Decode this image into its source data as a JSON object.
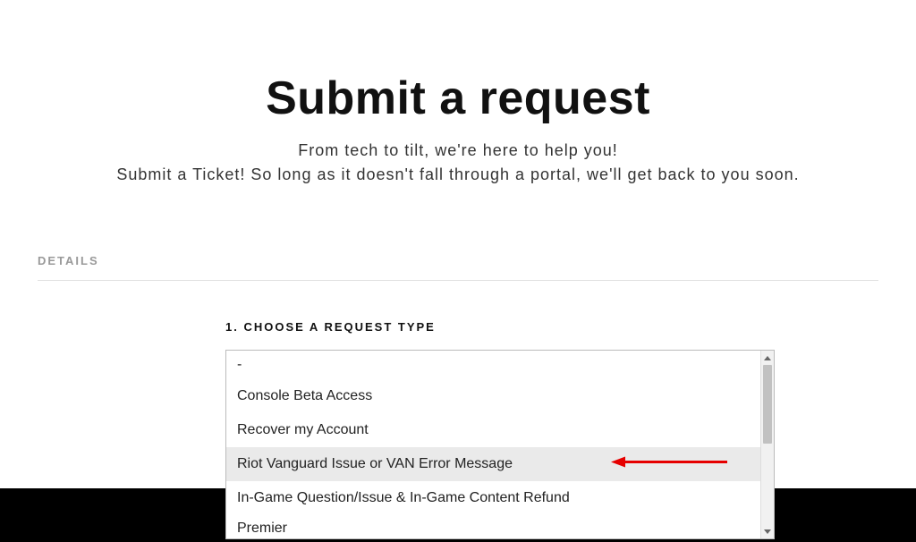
{
  "header": {
    "title": "Submit a request",
    "tagline1": "From tech to tilt, we're here to help you!",
    "tagline2": "Submit a Ticket! So long as it doesn't fall through a portal, we'll get back to you soon."
  },
  "section": {
    "label": "DETAILS"
  },
  "request": {
    "step_label": "1. CHOOSE A REQUEST TYPE",
    "options": [
      "-",
      "Console Beta Access",
      "Recover my Account",
      "Riot Vanguard Issue or VAN Error Message",
      "In-Game Question/Issue & In-Game Content Refund",
      "Premier"
    ],
    "highlighted_index": 3
  }
}
